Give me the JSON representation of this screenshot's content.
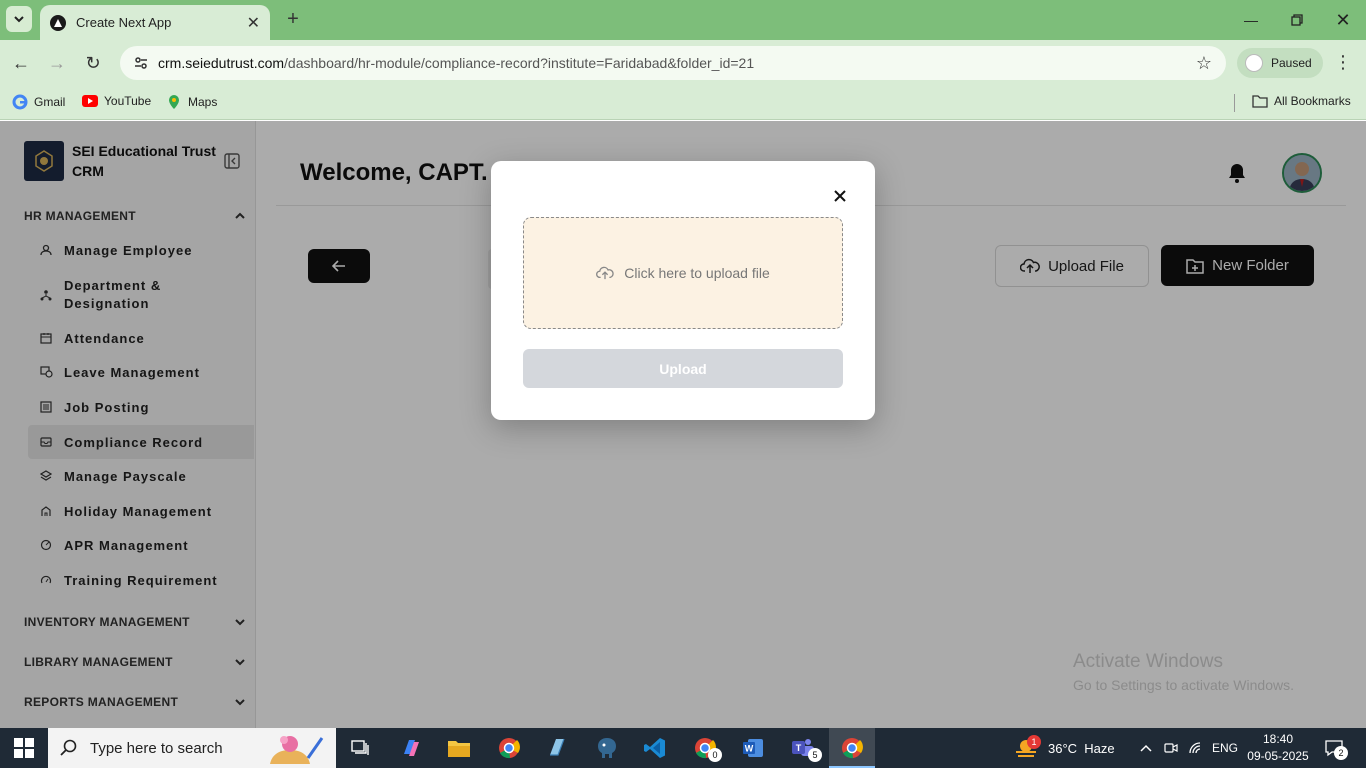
{
  "browser": {
    "tab_title": "Create Next App",
    "url_host": "crm.seiedutrust.com",
    "url_path": "/dashboard/hr-module/compliance-record?institute=Faridabad&folder_id=21",
    "profile_status": "Paused",
    "bookmarks": [
      {
        "label": "Gmail"
      },
      {
        "label": "YouTube"
      },
      {
        "label": "Maps"
      }
    ],
    "all_bookmarks": "All Bookmarks"
  },
  "sidebar": {
    "brand": "SEI Educational Trust CRM",
    "sections": [
      {
        "label": "HR MANAGEMENT",
        "expanded": true
      },
      {
        "label": "INVENTORY MANAGEMENT",
        "expanded": false
      },
      {
        "label": "LIBRARY MANAGEMENT",
        "expanded": false
      },
      {
        "label": "REPORTS MANAGEMENT",
        "expanded": false
      }
    ],
    "items": [
      {
        "label": "Manage Employee",
        "icon": "users-icon"
      },
      {
        "label": "Department & Designation",
        "icon": "network-icon"
      },
      {
        "label": "Attendance",
        "icon": "calendar-icon"
      },
      {
        "label": "Leave Management",
        "icon": "leave-icon"
      },
      {
        "label": "Job Posting",
        "icon": "newspaper-icon"
      },
      {
        "label": "Compliance Record",
        "icon": "inbox-icon",
        "active": true
      },
      {
        "label": "Manage Payscale",
        "icon": "layers-icon"
      },
      {
        "label": "Holiday Management",
        "icon": "holiday-icon"
      },
      {
        "label": "APR Management",
        "icon": "target-icon"
      },
      {
        "label": "Training Requirement",
        "icon": "gauge-icon"
      }
    ]
  },
  "main": {
    "welcome": "Welcome, CAPT.",
    "upload_file_label": "Upload File",
    "new_folder_label": "New Folder"
  },
  "modal": {
    "dropzone_text": "Click here to upload file",
    "upload_label": "Upload"
  },
  "watermark": {
    "line1": "Activate Windows",
    "line2": "Go to Settings to activate Windows."
  },
  "taskbar": {
    "search_placeholder": "Type here to search",
    "weather": "36°C  Haze",
    "weather_badge": "1",
    "language": "ENG",
    "time": "18:40",
    "date": "09-05-2025",
    "notifications": "2",
    "teams_badge": "5",
    "chrome_badge": "0"
  },
  "colors": {
    "browser_frame": "#7dbe7a",
    "toolbar": "#d8ecd5",
    "dropzone": "#fcf2e3",
    "primary_button": "#111111"
  }
}
